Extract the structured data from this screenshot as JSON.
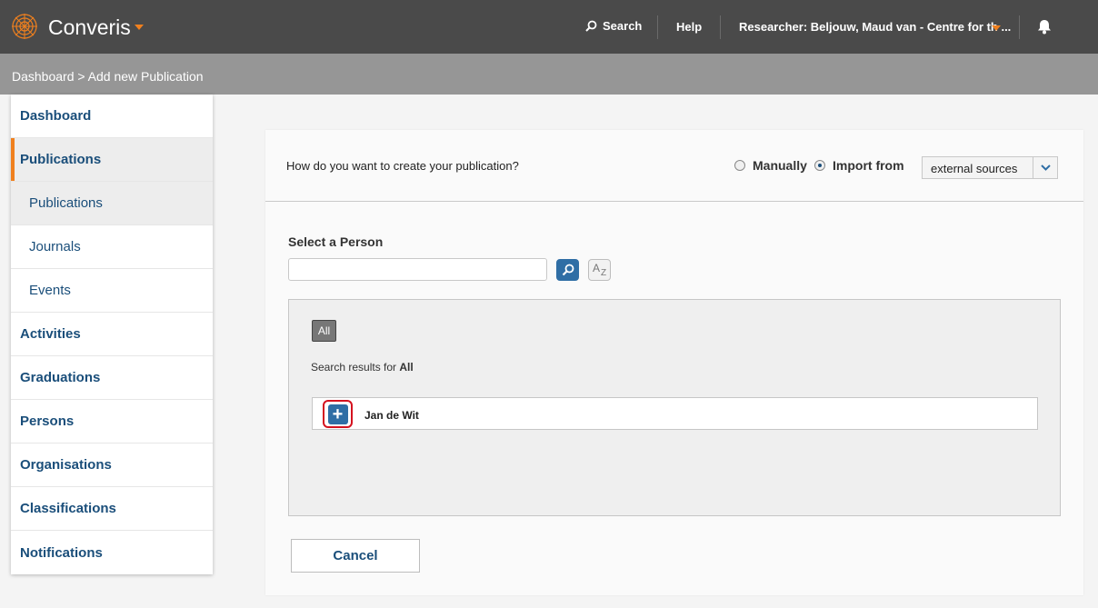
{
  "header": {
    "app_name": "Converis",
    "search_label": "Search",
    "help_label": "Help",
    "user_label": "Researcher: Beljouw, Maud van - Centre for th ...",
    "accent_color": "#f0801e",
    "background_color": "#4a4a4a"
  },
  "breadcrumb": {
    "text": "Dashboard > Add new Publication"
  },
  "sidebar": {
    "items": [
      {
        "label": "Dashboard"
      },
      {
        "label": "Publications"
      },
      {
        "label": "Publications"
      },
      {
        "label": "Journals"
      },
      {
        "label": "Events"
      },
      {
        "label": "Activities"
      },
      {
        "label": "Graduations"
      },
      {
        "label": "Persons"
      },
      {
        "label": "Organisations"
      },
      {
        "label": "Classifications"
      },
      {
        "label": "Notifications"
      }
    ]
  },
  "form": {
    "question": "How do you want to create your publication?",
    "option_manual": "Manually",
    "option_import": "Import from",
    "selected_option": "Import from",
    "source_select_value": "external sources",
    "select_person_label": "Select a Person",
    "search_value": "",
    "filter_chip": "All",
    "results_prefix": "Search results for",
    "results_term": "All",
    "results": [
      {
        "name": "Jan de Wit"
      }
    ],
    "cancel_label": "Cancel"
  }
}
